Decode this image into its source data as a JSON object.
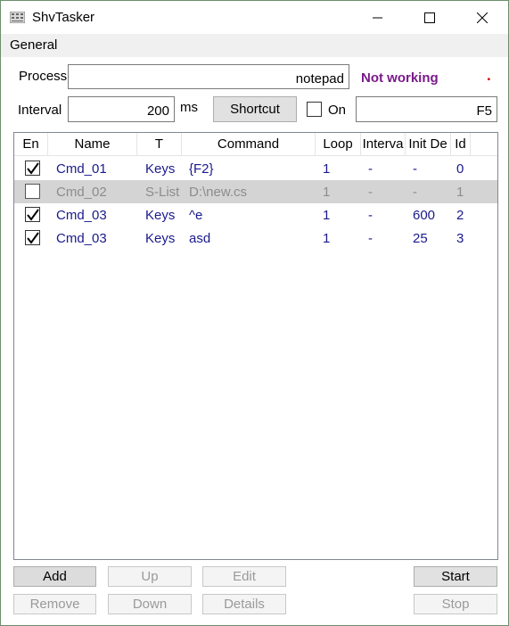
{
  "window": {
    "title": "ShvTasker",
    "minimize_glyph": "—",
    "maximize_glyph": "☐",
    "close_glyph": "✕"
  },
  "menu": {
    "general": "General"
  },
  "process": {
    "label": "Process",
    "value": "notepad",
    "status": "Not working",
    "status_color": "#7a1a8a",
    "indicator": ".",
    "indicator_color": "#cc0000"
  },
  "interval": {
    "label": "Interval",
    "value": "200",
    "unit": "ms",
    "shortcut_button": "Shortcut",
    "on_label": "On",
    "on_checked": false,
    "shortcut_value": "F5"
  },
  "table": {
    "columns": [
      "En",
      "Name",
      "T",
      "Command",
      "Loop",
      "Interva",
      "Init De",
      "Id"
    ],
    "rows": [
      {
        "enabled": true,
        "name": "Cmd_01",
        "type": "Keys",
        "command": "{F2}",
        "loop": "1",
        "interval": "-",
        "init_delay": "-",
        "id": "0",
        "selected": false
      },
      {
        "enabled": false,
        "name": "Cmd_02",
        "type": "S-List",
        "command": "D:\\new.cs",
        "loop": "1",
        "interval": "-",
        "init_delay": "-",
        "id": "1",
        "selected": true
      },
      {
        "enabled": true,
        "name": "Cmd_03",
        "type": "Keys",
        "command": "^e",
        "loop": "1",
        "interval": "-",
        "init_delay": "600",
        "id": "2",
        "selected": false
      },
      {
        "enabled": true,
        "name": "Cmd_03",
        "type": "Keys",
        "command": "asd",
        "loop": "1",
        "interval": "-",
        "init_delay": "25",
        "id": "3",
        "selected": false
      }
    ]
  },
  "buttons": {
    "add": "Add",
    "up": "Up",
    "edit": "Edit",
    "start": "Start",
    "remove": "Remove",
    "down": "Down",
    "details": "Details",
    "stop": "Stop"
  },
  "colors": {
    "row_text": "#1a1a8c",
    "row_disabled_text": "#8c8c8c",
    "selected_row_bg": "#d4d4d4"
  }
}
